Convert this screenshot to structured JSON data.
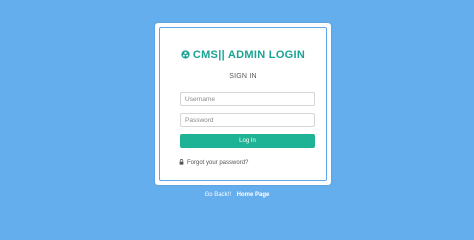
{
  "login": {
    "title": "CMS|| ADMIN LOGIN",
    "heading": "SIGN IN",
    "username_placeholder": "Username",
    "password_placeholder": "Password",
    "login_button": "Log In",
    "forgot_link": "Forgot your password?"
  },
  "footer": {
    "prefix": "Go Back!!",
    "home_link": "Home Page"
  },
  "icons": {
    "brand": "globe-icon",
    "forgot": "lock-icon"
  },
  "colors": {
    "background": "#64aeee",
    "accent": "#1aa394",
    "button": "#1db394"
  }
}
